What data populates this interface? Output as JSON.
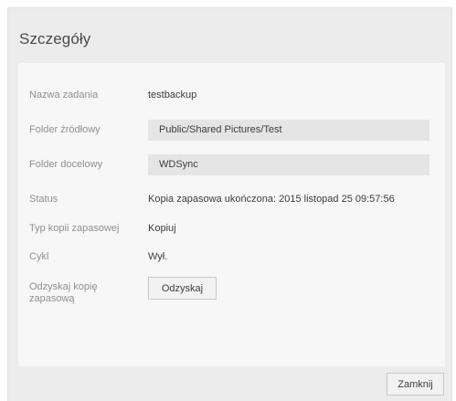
{
  "dialog": {
    "title": "Szczegóły"
  },
  "details": {
    "task_name_label": "Nazwa zadania",
    "task_name_value": "testbackup",
    "source_folder_label": "Folder źródłowy",
    "source_folder_value": "Public/Shared Pictures/Test",
    "dest_folder_label": "Folder docelowy",
    "dest_folder_value": "WDSync",
    "status_label": "Status",
    "status_value": "Kopia zapasowa ukończona: 2015 listopad 25 09:57:56",
    "backup_type_label": "Typ kopii zapasowej",
    "backup_type_value": "Kopiuj",
    "cycle_label": "Cykl",
    "cycle_value": "Wył.",
    "recover_label": "Odzyskaj kopię zapasową",
    "recover_button": "Odzyskaj"
  },
  "footer": {
    "close_button": "Zamknij"
  }
}
